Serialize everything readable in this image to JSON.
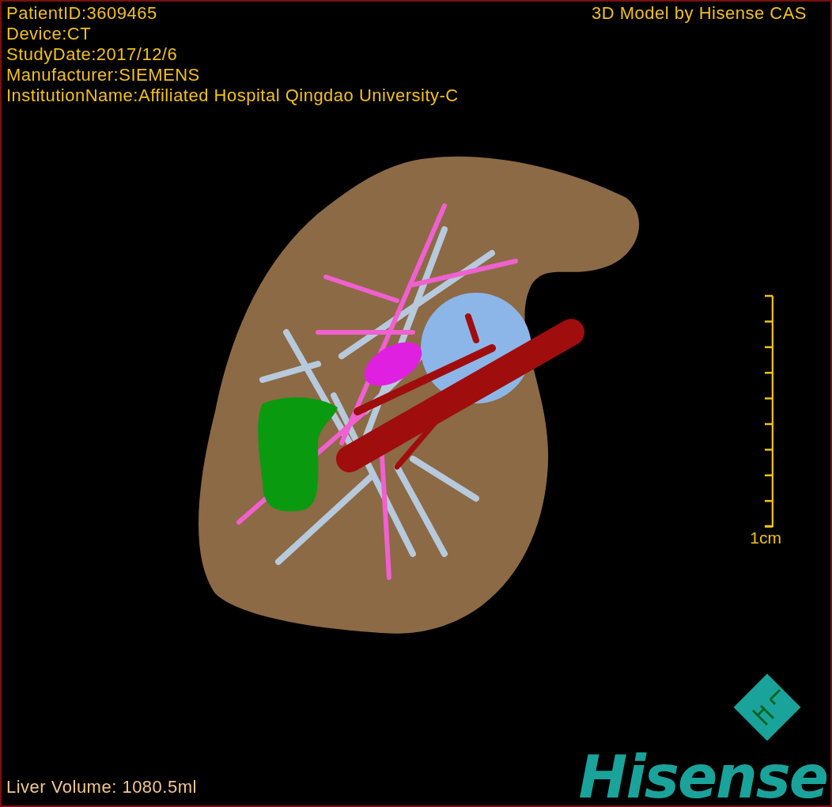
{
  "viewer": {
    "info_lines": [
      "PatientID:3609465",
      "Device:CT",
      "StudyDate:2017/12/6",
      "Manufacturer:SIEMENS",
      "InstitutionName:Affiliated Hospital Qingdao University-C"
    ],
    "credit": "3D Model by Hisense CAS",
    "scale_bar": {
      "label": "1cm"
    },
    "liver_volume": "Liver Volume: 1080.5ml",
    "logo": {
      "wordmark": "Hisense"
    }
  }
}
